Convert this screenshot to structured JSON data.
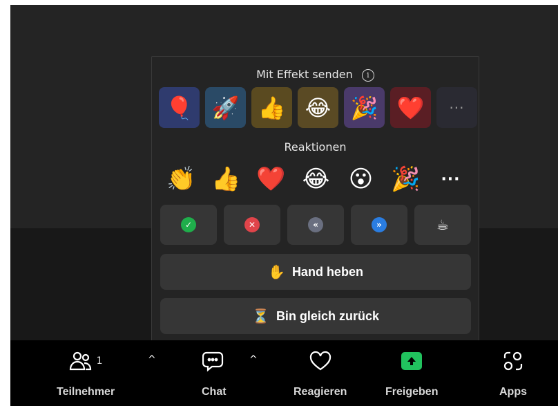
{
  "popup": {
    "effect_title": "Mit Effekt senden",
    "reactions_title": "Reaktionen",
    "effect_tiles": [
      {
        "emoji": "🎈",
        "bg": "#2f3b6e"
      },
      {
        "emoji": "🚀",
        "bg": "#2a4a66"
      },
      {
        "emoji": "👍",
        "bg": "#5a4a20"
      },
      {
        "emoji": "😂",
        "bg": "#5a4a24"
      },
      {
        "emoji": "🎉",
        "bg": "#4a3a6a"
      },
      {
        "emoji": "❤️",
        "bg": "#5a1e24"
      }
    ],
    "more": "···",
    "reactions": [
      "👏",
      "👍",
      "❤️",
      "😂",
      "😮",
      "🎉"
    ],
    "status_buttons": [
      {
        "symbol": "✓",
        "color": "#1fae4b"
      },
      {
        "symbol": "✕",
        "color": "#e0444a"
      },
      {
        "symbol": "«",
        "color": "#6a6f80"
      },
      {
        "symbol": "»",
        "color": "#2a7de1"
      },
      {
        "symbol": "☕",
        "color": ""
      }
    ],
    "hand_label": "Hand heben",
    "hand_emoji": "✋",
    "brb_label": "Bin gleich zurück",
    "brb_emoji": "⏳"
  },
  "toolbar": {
    "participants_label": "Teilnehmer",
    "participants_count": "1",
    "chat_label": "Chat",
    "react_label": "Reagieren",
    "share_label": "Freigeben",
    "apps_label": "Apps",
    "caret": "^",
    "share_color": "#21c25e"
  }
}
